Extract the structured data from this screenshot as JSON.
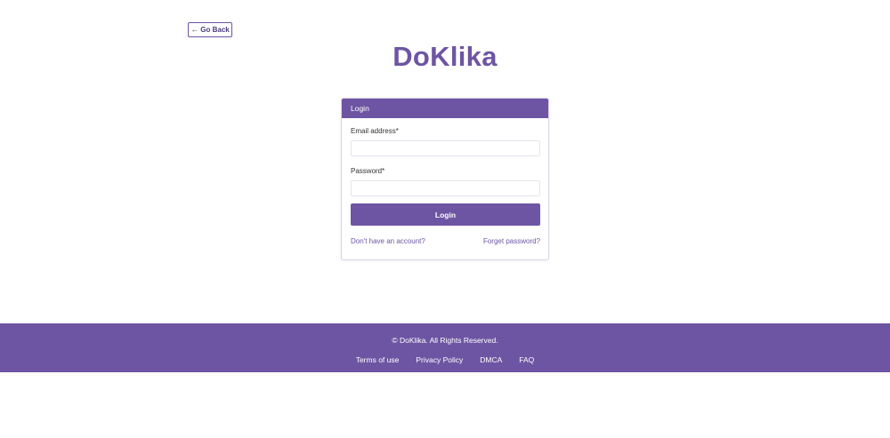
{
  "back_button": {
    "arrow": "←",
    "label": "Go Back"
  },
  "brand": {
    "name": "DoKlika"
  },
  "login_card": {
    "header": "Login",
    "email_label": "Email address*",
    "email_value": "",
    "password_label": "Password*",
    "password_value": "",
    "submit_label": "Login",
    "signup_link": "Don't have an account?",
    "forgot_link": "Forget password?"
  },
  "footer": {
    "copyright": "© DoKlika. All Rights Reserved.",
    "links": [
      "Terms of use",
      "Privacy Policy",
      "DMCA",
      "FAQ"
    ]
  },
  "colors": {
    "accent": "#6d55a3",
    "background": "#ffffff"
  }
}
